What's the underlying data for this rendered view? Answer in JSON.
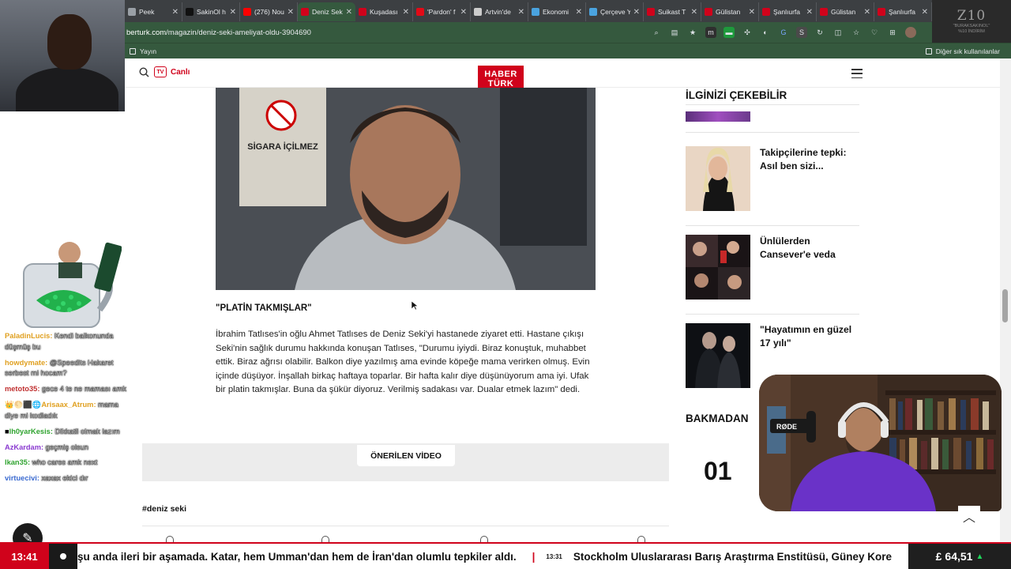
{
  "browser": {
    "tabs": [
      {
        "title": "Peek",
        "fav": "#9aa0a6"
      },
      {
        "title": "SakinOl h",
        "fav": "#111111"
      },
      {
        "title": "(276) Nou",
        "fav": "#ff0000"
      },
      {
        "title": "Deniz Seki",
        "fav": "#d0021b",
        "active": true
      },
      {
        "title": "Kuşadası",
        "fav": "#d0021b"
      },
      {
        "title": "'Pardon' f",
        "fav": "#e30a17"
      },
      {
        "title": "Artvin'de",
        "fav": "#cccccc"
      },
      {
        "title": "Ekonomi",
        "fav": "#4aa3df"
      },
      {
        "title": "Çerçeve Y",
        "fav": "#4aa3df"
      },
      {
        "title": "Suikast T",
        "fav": "#d0021b"
      },
      {
        "title": "Gülistan",
        "fav": "#d0021b"
      },
      {
        "title": "Şanlıurfa",
        "fav": "#d0021b"
      },
      {
        "title": "Gülistan",
        "fav": "#d0021b"
      },
      {
        "title": "Şanlıurfa",
        "fav": "#d0021b"
      }
    ],
    "new_tab": "+",
    "url_domain": "berturk.com",
    "url_path": "/magazin/deniz-seki-ameliyat-oldu-3904690",
    "bookmark_left": "Yayın",
    "bookmark_right": "Diğer sık kullanılanlar"
  },
  "overlay": {
    "logo_mark": "Z10",
    "logo_line1": "\"BURAKSAKINOL\"",
    "logo_line2": "%10 İNDİRİM"
  },
  "chat": [
    {
      "user": "PaladinLucis",
      "color": "#e0a020",
      "text": "Kendi balkonunda düşmüş bu"
    },
    {
      "user": "howdymate",
      "color": "#e0a020",
      "text": "@Speedits Hakaret serbest mi hocam?"
    },
    {
      "user": "metoto35",
      "color": "#c03030",
      "text": "gece 4 te ne maması amk"
    },
    {
      "user": "Arisaax_Atrum",
      "color": "#e0a020",
      "text": "mama diye mi kodladık",
      "badges": "👑🌕⬛🌐"
    },
    {
      "user": "lh0yarKesis",
      "color": "#2fa32f",
      "text": "Dikkatli olmak lazım",
      "badges": "■"
    },
    {
      "user": "AzKardam",
      "color": "#8a3ad0",
      "text": "geçmiş olsun"
    },
    {
      "user": "lkan35",
      "color": "#2fa32f",
      "text": "who cares amk next"
    },
    {
      "user": "virtuecivi",
      "color": "#3a6ad0",
      "text": "xaxax ekici dır"
    }
  ],
  "site": {
    "search_label": "search",
    "tv_badge": "TV",
    "live_label": "Canlı",
    "logo_top": "HABER",
    "logo_bottom": "TÜRK"
  },
  "article": {
    "subhead": "\"PLATİN TAKMIŞLAR\"",
    "paragraph": "İbrahim Tatlıses'in oğlu Ahmet Tatlıses de Deniz Seki'yi hastanede ziyaret etti. Hastane çıkışı Seki'nin sağlık durumu hakkında konuşan Tatlıses, \"Durumu iyiydi. Biraz konuştuk, muhabbet ettik. Biraz ağrısı olabilir. Balkon diye yazılmış ama evinde köpeğe mama verirken olmuş. Evin içinde düşüyor. İnşallah birkaç haftaya toparlar. Bir hafta kalır diye düşünüyorum ama iyi. Ufak bir platin takmışlar. Buna da şükür diyoruz. Verilmiş sadakası var. Dualar etmek lazım\" dedi.",
    "photo_sign": "SİGARA İÇİLMEZ",
    "recommended_video": "ÖNERİLEN VİDEO",
    "tag": "#deniz seki"
  },
  "sidebar": {
    "title": "İLGİNİZİ ÇEKEBİLİR",
    "cards": [
      {
        "title": "Takipçilerine tepki: Asıl ben sizi..."
      },
      {
        "title": "Ünlülerden Cansever'e veda"
      },
      {
        "title": "\"Hayatımın en güzel 17 yılı\""
      }
    ],
    "section2_title": "BAKMADAN",
    "rank_number": "01"
  },
  "ticker": {
    "time": "13:41",
    "headline1": "şu anda ileri bir aşamada. Katar, hem Umman'dan hem de İran'dan olumlu tepkiler aldı.",
    "separator": "|",
    "small_time": "13:31",
    "headline2": "Stockholm Uluslararası Barış Araştırma Enstitüsü, Güney Kore",
    "gold_symbol": "£",
    "gold_value": "64,51",
    "gold_trend": "▲"
  },
  "colors": {
    "brand_red": "#d0021b",
    "browser_green": "#35593e",
    "tab_dark": "#3c3f42"
  }
}
